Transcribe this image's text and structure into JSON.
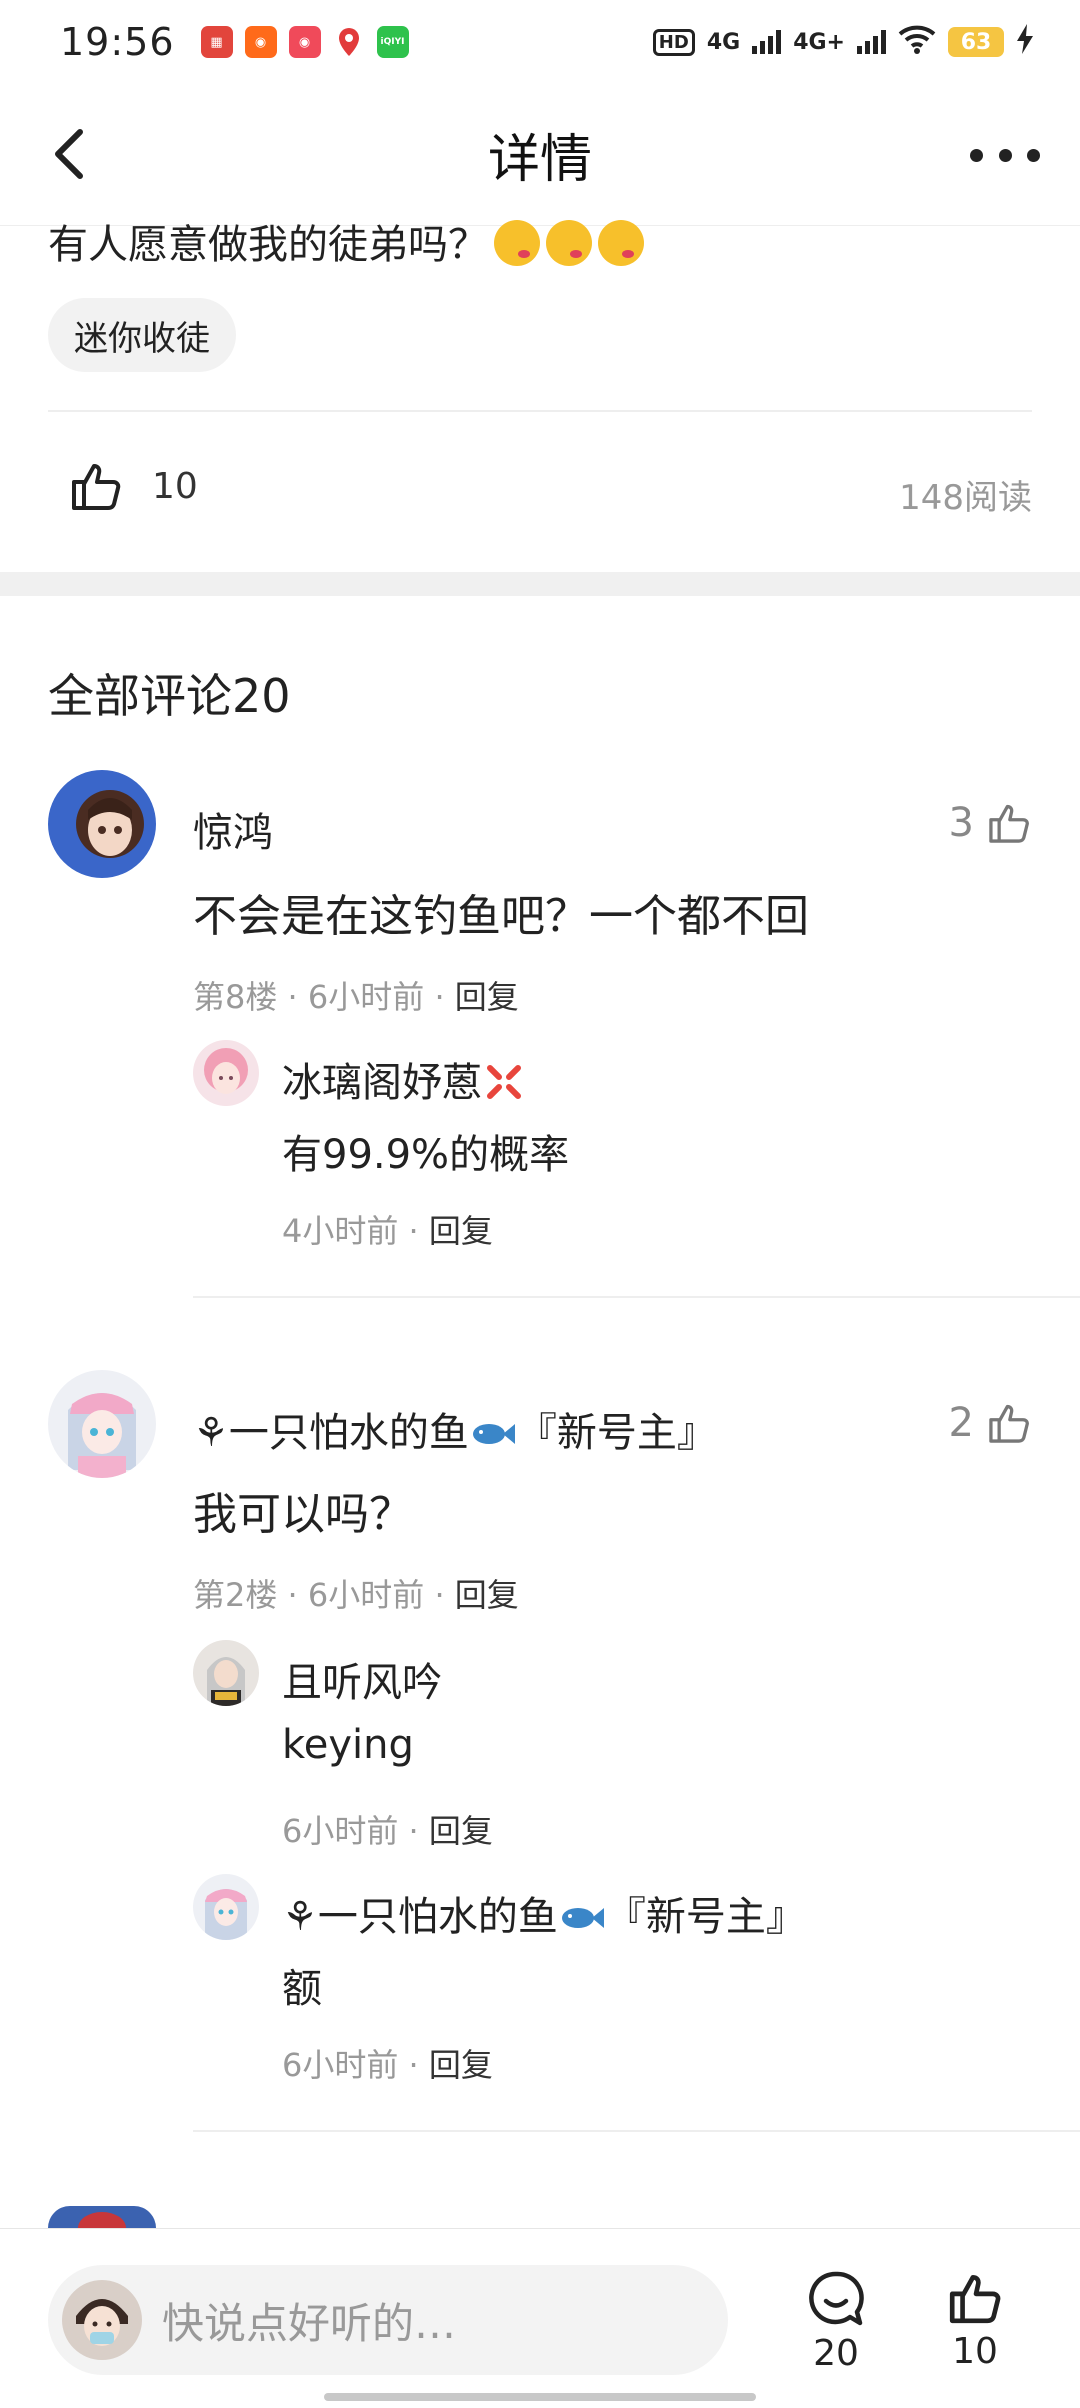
{
  "status_bar": {
    "time": "19:56",
    "network_left": "HD",
    "network_1": "4G",
    "network_2": "4G+",
    "battery": "63",
    "apps": [
      "app-red-1",
      "app-orange-1",
      "app-red-2",
      "app-map",
      "app-iqiyi"
    ]
  },
  "header": {
    "title": "详情"
  },
  "post": {
    "text": "有人愿意做我的徒弟吗？",
    "tag": "迷你收徒",
    "like_count": "10",
    "read_count": "148阅读"
  },
  "comments_section": {
    "title": "全部评论20"
  },
  "comments": [
    {
      "name": "惊鸿",
      "text": "不会是在这钓鱼吧？一个都不回",
      "floor": "第8楼",
      "time": "6小时前",
      "reply_label": "回复",
      "likes": "3",
      "replies": [
        {
          "name": "冰璃阁妤蒽",
          "text": "有99.9%的概率",
          "time": "4小时前",
          "reply_label": "回复"
        }
      ]
    },
    {
      "name": "一只怕水的鱼",
      "name_suffix": "『新号主』",
      "text": "我可以吗？",
      "floor": "第2楼",
      "time": "6小时前",
      "reply_label": "回复",
      "likes": "2",
      "replies": [
        {
          "name": "且听风吟",
          "text": "keying",
          "time": "6小时前",
          "reply_label": "回复"
        },
        {
          "name": "一只怕水的鱼",
          "name_suffix": "『新号主』",
          "text": "额",
          "time": "6小时前",
          "reply_label": "回复"
        }
      ]
    }
  ],
  "bottom_bar": {
    "placeholder": "快说点好听的…",
    "comment_count": "20",
    "like_count": "10"
  },
  "colors": {
    "accent_gold": "#f5c542",
    "muted": "#999999",
    "divider": "#eeeeee"
  }
}
